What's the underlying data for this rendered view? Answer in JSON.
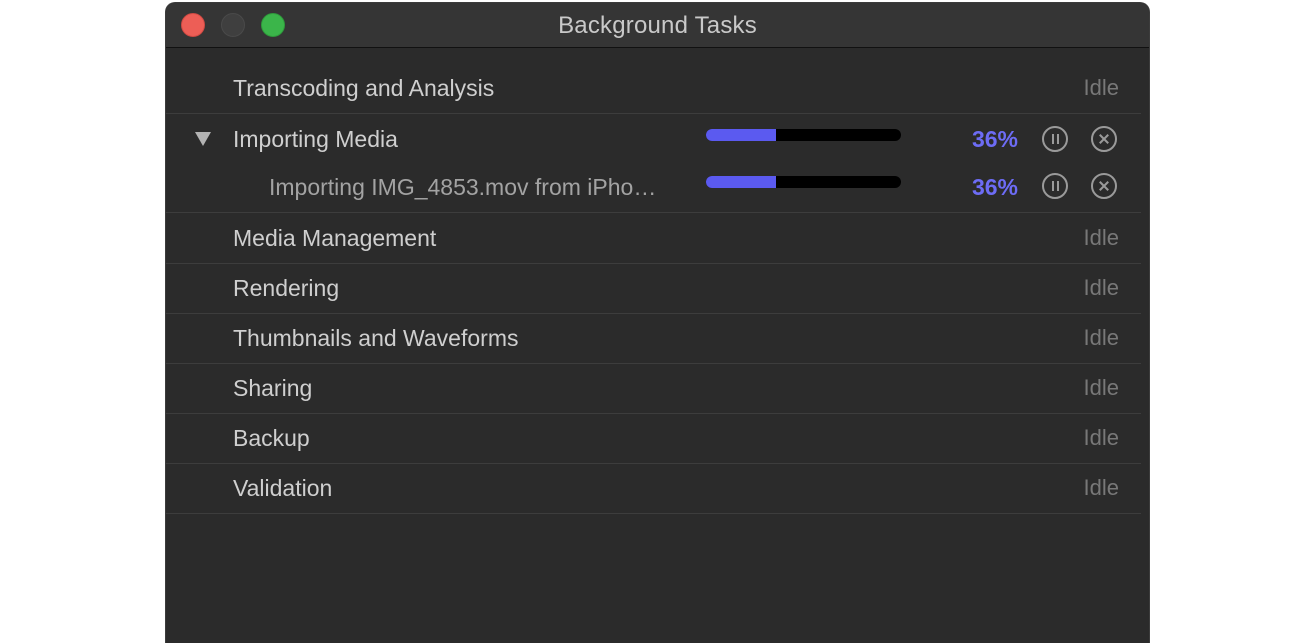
{
  "window": {
    "title": "Background Tasks"
  },
  "tasks": [
    {
      "label": "Transcoding and Analysis",
      "status": "Idle"
    },
    {
      "label": "Importing Media",
      "expanded": true,
      "progress_percent": 36,
      "progress_text": "36%",
      "children": [
        {
          "label": "Importing IMG_4853.mov from iPho…",
          "progress_percent": 36,
          "progress_text": "36%"
        }
      ]
    },
    {
      "label": "Media Management",
      "status": "Idle"
    },
    {
      "label": "Rendering",
      "status": "Idle"
    },
    {
      "label": "Thumbnails and Waveforms",
      "status": "Idle"
    },
    {
      "label": "Sharing",
      "status": "Idle"
    },
    {
      "label": "Backup",
      "status": "Idle"
    },
    {
      "label": "Validation",
      "status": "Idle"
    }
  ],
  "icons": {
    "disclosure": "triangle-down-icon",
    "pause": "pause-circle-icon",
    "cancel": "cancel-circle-icon"
  },
  "colors": {
    "accent": "#5b5af0",
    "percent_text": "#6d6cf5",
    "close_light": "#ed5e56",
    "zoom_light": "#3bb54a"
  }
}
